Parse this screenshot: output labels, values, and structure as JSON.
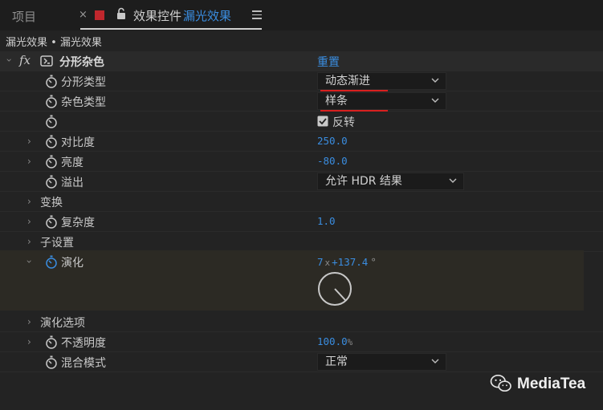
{
  "tabs": {
    "project": "项目",
    "close": "×",
    "title": "效果控件",
    "comp": "漏光效果"
  },
  "breadcrumb": "漏光效果 • 漏光效果",
  "effect": {
    "name": "分形杂色",
    "fx_label": "fx",
    "reset": "重置"
  },
  "params": {
    "fractal_type": {
      "label": "分形类型",
      "value": "动态渐进"
    },
    "noise_type": {
      "label": "杂色类型",
      "value": "样条"
    },
    "invert": {
      "label": "反转",
      "checked": true
    },
    "contrast": {
      "label": "对比度",
      "value": "250.0"
    },
    "brightness": {
      "label": "亮度",
      "value": "-80.0"
    },
    "overflow": {
      "label": "溢出",
      "value": "允许 HDR 结果"
    },
    "transform": {
      "label": "变换"
    },
    "complexity": {
      "label": "复杂度",
      "value": "1.0"
    },
    "sub_settings": {
      "label": "子设置"
    },
    "evolution": {
      "label": "演化",
      "revolutions": "7",
      "x": "x",
      "degrees": "+137.4",
      "deg_sign": "°"
    },
    "evolution_options": {
      "label": "演化选项"
    },
    "opacity": {
      "label": "不透明度",
      "value": "100.0",
      "unit": "%"
    },
    "blend_mode": {
      "label": "混合模式",
      "value": "正常"
    }
  },
  "watermark": "MediaTea",
  "colors": {
    "accent": "#3a8de0",
    "annotation": "#d8201f",
    "swatch": "#c0272d"
  }
}
